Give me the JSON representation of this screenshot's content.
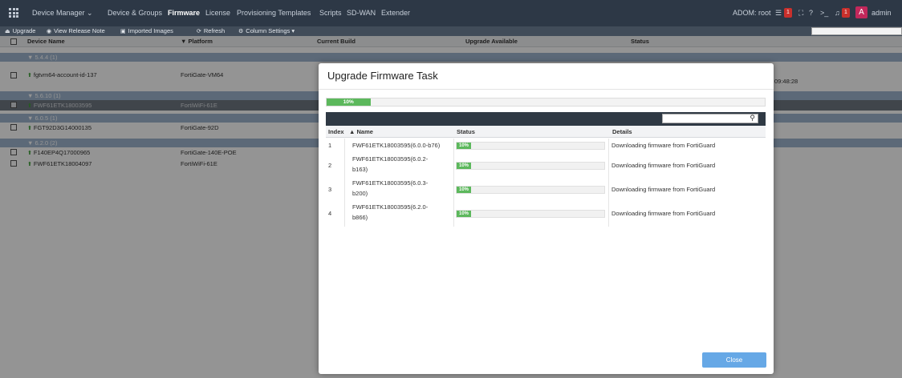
{
  "topnav": {
    "items": [
      {
        "label": "Device Manager ⌄",
        "active": false
      },
      {
        "label": "Device & Groups",
        "active": false
      },
      {
        "label": "Firmware",
        "active": true
      },
      {
        "label": "License",
        "active": false
      },
      {
        "label": "Provisioning Templates",
        "active": false
      },
      {
        "label": "Scripts",
        "active": false
      },
      {
        "label": "SD-WAN",
        "active": false
      },
      {
        "label": "Extender",
        "active": false
      }
    ],
    "adom": "ADOM: root",
    "task_badge": "1",
    "alert_badge": "1",
    "cli_label": ">_",
    "help_label": "?",
    "fullscreen_label": "⛶",
    "avatar_letter": "A",
    "user": "admin"
  },
  "toolbar": {
    "upgrade": "Upgrade",
    "view_release_note": "View Release Note",
    "imported_images": "Imported Images",
    "refresh": "Refresh",
    "column_settings": "Column Settings ▾"
  },
  "grid": {
    "columns": [
      "Device Name",
      "Platform",
      "Current Build",
      "Upgrade Available",
      "Status"
    ],
    "groups": [
      {
        "label": "▼ 5.4.4 (1)"
      },
      {
        "label": "▼ 5.6.10 (1)"
      },
      {
        "label": "▼ 6.0.5 (1)"
      },
      {
        "label": "▼ 6.2.0 (2)"
      }
    ],
    "rows": [
      {
        "name": "fgtvm64-account-id-137",
        "platform": "FortiGate-VM64",
        "status": "09:48:28"
      },
      {
        "name": "FWF61ETK18003595",
        "platform": "FortiWiFi-61E",
        "status": ""
      },
      {
        "name": "FGT92D3G14000135",
        "platform": "FortiGate-92D",
        "status": ""
      },
      {
        "name": "F140EP4Q17000965",
        "platform": "FortiGate-140E-POE",
        "status": ""
      },
      {
        "name": "FWF61ETK18004097",
        "platform": "FortiWiFi-61E",
        "status": ""
      }
    ]
  },
  "modal": {
    "title": "Upgrade Firmware Task",
    "overall_progress": "10%",
    "overall_progress_fraction": 0.1,
    "columns": {
      "index": "Index",
      "name": "▲ Name",
      "status": "Status",
      "details": "Details"
    },
    "tasks": [
      {
        "index": "1",
        "name_line1": "FWF61ETK18003595(6.0.0-b76)",
        "name_line2": "",
        "progress": "10%",
        "details": "Downloading firmware from FortiGuard"
      },
      {
        "index": "2",
        "name_line1": "FWF61ETK18003595(6.0.2-",
        "name_line2": "b163)",
        "progress": "10%",
        "details": "Downloading firmware from FortiGuard"
      },
      {
        "index": "3",
        "name_line1": "FWF61ETK18003595(6.0.3-",
        "name_line2": "b200)",
        "progress": "10%",
        "details": "Downloading firmware from FortiGuard"
      },
      {
        "index": "4",
        "name_line1": "FWF61ETK18003595(6.2.0-",
        "name_line2": "b866)",
        "progress": "10%",
        "details": "Downloading firmware from FortiGuard"
      }
    ],
    "close_label": "Close"
  }
}
